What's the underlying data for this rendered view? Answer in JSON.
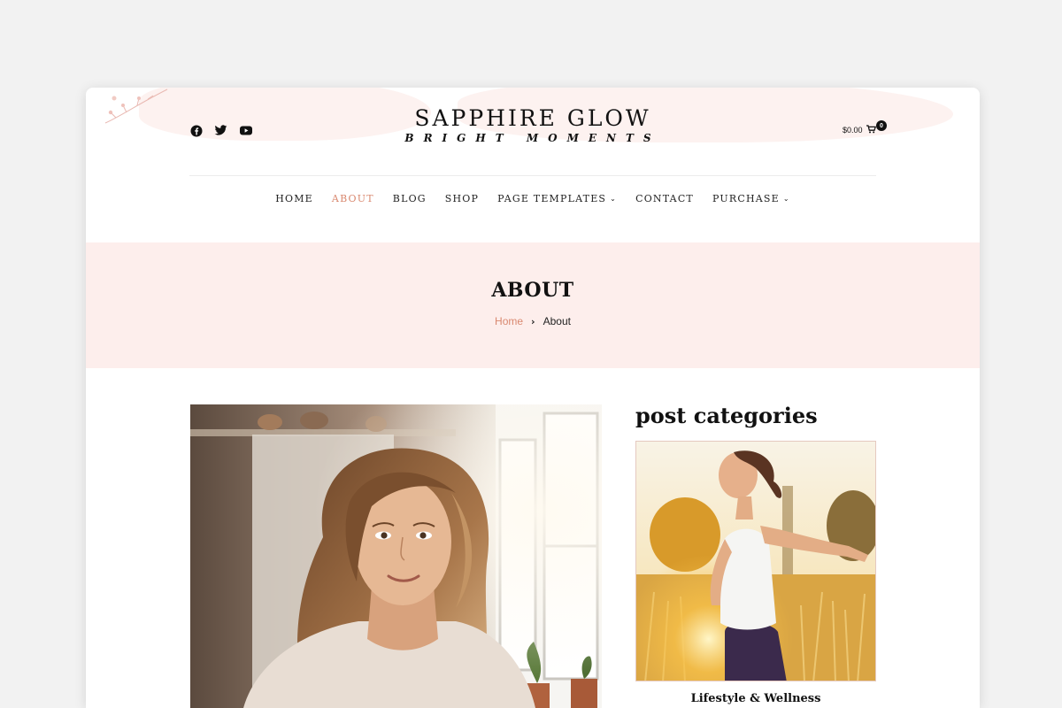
{
  "site": {
    "title": "SAPPHIRE GLOW",
    "tagline": "BRIGHT MOMENTS"
  },
  "social": [
    "facebook-icon",
    "twitter-icon",
    "youtube-icon"
  ],
  "cart": {
    "amount": "$0.00",
    "count": "0"
  },
  "nav": {
    "items": [
      {
        "label": "HOME"
      },
      {
        "label": "ABOUT"
      },
      {
        "label": "BLOG"
      },
      {
        "label": "SHOP"
      },
      {
        "label": "PAGE TEMPLATES"
      },
      {
        "label": "CONTACT"
      },
      {
        "label": "PURCHASE"
      }
    ],
    "active": "ABOUT"
  },
  "page": {
    "title": "ABOUT",
    "breadcrumb": {
      "home": "Home",
      "current": "About"
    }
  },
  "sidebar": {
    "title": "post categories",
    "category": "Lifestyle & Wellness"
  },
  "colors": {
    "accent": "#d9886f",
    "band": "#fdeeec",
    "text": "#222222"
  }
}
